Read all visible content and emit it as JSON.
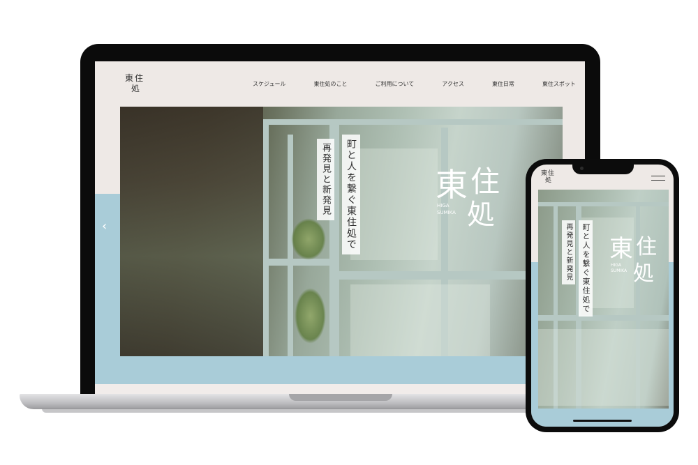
{
  "site": {
    "logo_text": "東住処",
    "nav": [
      "スケジュール",
      "東住処のこと",
      "ご利用について",
      "アクセス",
      "東住日常",
      "東住スポット"
    ],
    "hero": {
      "tagline_1": "町と人を繋ぐ東住処で",
      "tagline_2": "再発見と新発見",
      "logo_kanji_1": "東",
      "logo_kanji_2": "住",
      "logo_kanji_3": "処",
      "logo_romaji_1": "HIGA",
      "logo_romaji_2": "SUMIKA",
      "prev_arrow": "‹"
    }
  },
  "phone": {
    "logo_text": "東住処",
    "menu_icon": "hamburger-icon"
  },
  "colors": {
    "page_bg": "#eee9e6",
    "accent_blue": "#a9ccd8",
    "device_black": "#0b0b0b"
  }
}
